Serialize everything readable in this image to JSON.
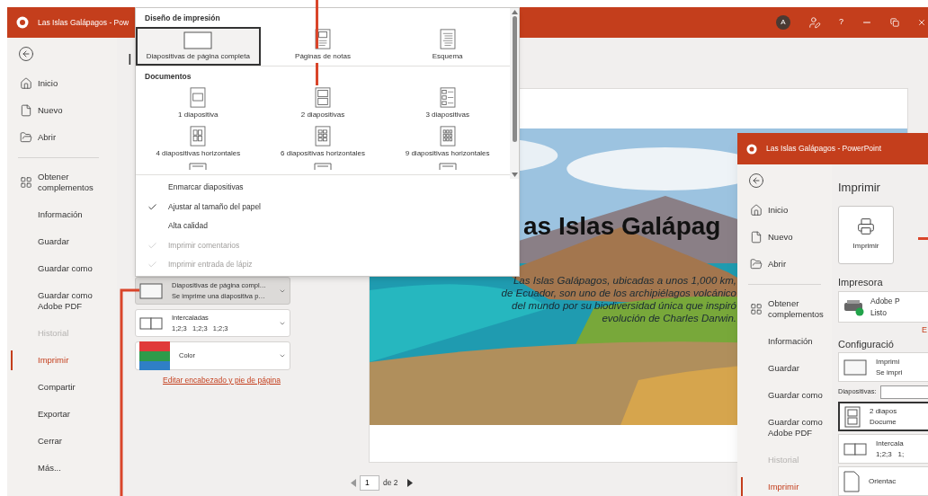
{
  "window": {
    "title": "Las Islas Galápagos - Pow",
    "avatar": "A",
    "help": "?"
  },
  "sidebar": {
    "items": [
      {
        "label": "Inicio",
        "kind": "home",
        "selected": false,
        "disabled": false
      },
      {
        "label": "Nuevo",
        "kind": "new",
        "selected": false,
        "disabled": false
      },
      {
        "label": "Abrir",
        "kind": "open",
        "selected": false,
        "disabled": false
      },
      {
        "label": "Obtener complementos",
        "kind": "addins",
        "selected": false,
        "disabled": false
      },
      {
        "label": "Información",
        "kind": "plain",
        "selected": false,
        "disabled": false
      },
      {
        "label": "Guardar",
        "kind": "plain",
        "selected": false,
        "disabled": false
      },
      {
        "label": "Guardar como",
        "kind": "plain",
        "selected": false,
        "disabled": false
      },
      {
        "label": "Guardar como Adobe PDF",
        "kind": "plain",
        "selected": false,
        "disabled": false
      },
      {
        "label": "Historial",
        "kind": "plain",
        "selected": false,
        "disabled": true
      },
      {
        "label": "Imprimir",
        "kind": "plain",
        "selected": true,
        "disabled": false
      },
      {
        "label": "Compartir",
        "kind": "plain",
        "selected": false,
        "disabled": false
      },
      {
        "label": "Exportar",
        "kind": "plain",
        "selected": false,
        "disabled": false
      },
      {
        "label": "Cerrar",
        "kind": "plain",
        "selected": false,
        "disabled": false
      },
      {
        "label": "Más...",
        "kind": "plain",
        "selected": false,
        "disabled": false
      }
    ]
  },
  "print_heading": "I",
  "settings": [
    {
      "kind": "layout",
      "title": "Diapositivas de página compl…",
      "subtitle": "Se imprime una diapositiva p…",
      "selected": true
    },
    {
      "kind": "collate",
      "title": "Intercaladas",
      "subtitle": "1;2;3   1;2;3   1;2;3",
      "selected": false
    },
    {
      "kind": "color",
      "title": "Color",
      "selected": false
    }
  ],
  "header_footer_link": "Editar encabezado y pie de página",
  "layout_menu": {
    "sections": [
      {
        "title": "Diseño de impresión",
        "items": [
          {
            "label": "Diapositivas de página completa",
            "kind": "full",
            "selected": true
          },
          {
            "label": "Páginas de notas",
            "kind": "notes",
            "selected": false
          },
          {
            "label": "Esquema",
            "kind": "outline",
            "selected": false
          }
        ]
      },
      {
        "title": "Documentos",
        "items": [
          {
            "label": "1 diapositiva",
            "kind": "h1",
            "selected": false
          },
          {
            "label": "2 diapositivas",
            "kind": "h2",
            "selected": false
          },
          {
            "label": "3 diapositivas",
            "kind": "h3",
            "selected": false
          },
          {
            "label": "4 diapositivas horizontales",
            "kind": "h4",
            "selected": false
          },
          {
            "label": "6 diapositivas horizontales",
            "kind": "h6",
            "selected": false
          },
          {
            "label": "9 diapositivas horizontales",
            "kind": "h9",
            "selected": false
          }
        ]
      }
    ],
    "options": [
      {
        "label": "Enmarcar diapositivas",
        "checked": false,
        "disabled": false
      },
      {
        "label": "Ajustar al tamaño del papel",
        "checked": true,
        "disabled": false
      },
      {
        "label": "Alta calidad",
        "checked": false,
        "disabled": false
      },
      {
        "label": "Imprimir comentarios",
        "checked": true,
        "disabled": true
      },
      {
        "label": "Imprimir entrada de lápiz",
        "checked": true,
        "disabled": true
      }
    ]
  },
  "preview": {
    "title": "as Islas Galápag",
    "body": [
      "Las Islas Galápagos, ubicadas a unos 1,000 km,",
      "de Ecuador, son uno de los archipiélagos volcánico",
      "del mundo por su biodiversidad única que inspiró",
      "evolución de Charles Darwin."
    ],
    "page": "1",
    "page_total": "de 2"
  },
  "second_window": {
    "title": "Las Islas Galápagos - PowerPoint",
    "sidebar": [
      {
        "label": "Inicio",
        "kind": "home",
        "selected": false,
        "disabled": false
      },
      {
        "label": "Nuevo",
        "kind": "new",
        "selected": false,
        "disabled": false
      },
      {
        "label": "Abrir",
        "kind": "open",
        "selected": false,
        "disabled": false
      },
      {
        "label": "Obtener complementos",
        "kind": "addins",
        "selected": false,
        "disabled": false
      },
      {
        "label": "Información",
        "kind": "plain",
        "selected": false,
        "disabled": false
      },
      {
        "label": "Guardar",
        "kind": "plain",
        "selected": false,
        "disabled": false
      },
      {
        "label": "Guardar como",
        "kind": "plain",
        "selected": false,
        "disabled": false
      },
      {
        "label": "Guardar como Adobe PDF",
        "kind": "plain",
        "selected": false,
        "disabled": false
      },
      {
        "label": "Historial",
        "kind": "plain",
        "selected": false,
        "disabled": true
      },
      {
        "label": "Imprimir",
        "kind": "plain",
        "selected": true,
        "disabled": false
      }
    ],
    "heading": "Imprimir",
    "print_button": "Imprimir",
    "printer_heading": "Impresora",
    "printer": {
      "name": "Adobe P",
      "status": "Listo"
    },
    "printer_link": "E",
    "settings_heading": "Configuració",
    "settings": [
      {
        "kind": "layout",
        "title": "Imprimi",
        "subtitle": "Se impri",
        "selected": false
      },
      {
        "kind": "slides_field",
        "label": "Diapositivas:"
      },
      {
        "kind": "handout",
        "title": "2 diapos",
        "subtitle": "Docume",
        "selected": true
      },
      {
        "kind": "collate",
        "title": "Intercala",
        "subtitle": "1;2;3   1;",
        "selected": false
      },
      {
        "kind": "orientation",
        "title": "Orientac",
        "selected": false
      }
    ]
  }
}
